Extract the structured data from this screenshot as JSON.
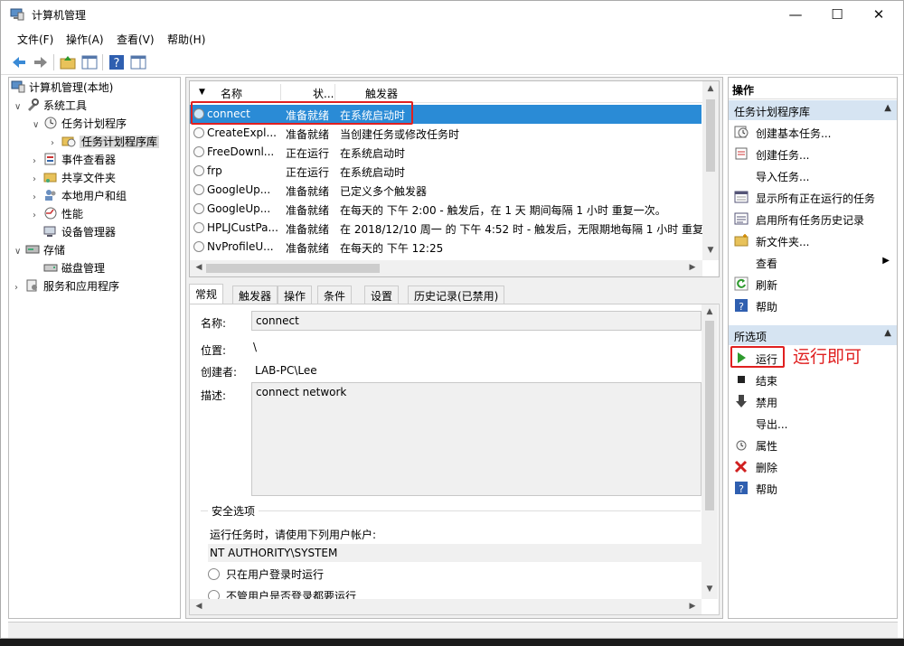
{
  "window": {
    "title": "计算机管理"
  },
  "menu": [
    "文件(F)",
    "操作(A)",
    "查看(V)",
    "帮助(H)"
  ],
  "tree": {
    "items": [
      {
        "label": "计算机管理(本地)",
        "level": 0,
        "expanded": true,
        "icon": "computer-mgmt-icon"
      },
      {
        "label": "系统工具",
        "level": 1,
        "expanded": true,
        "icon": "tools-icon"
      },
      {
        "label": "任务计划程序",
        "level": 2,
        "expanded": true,
        "icon": "clock-icon"
      },
      {
        "label": "任务计划程序库",
        "level": 3,
        "expanded": false,
        "icon": "folder-clock-icon",
        "selected": true
      },
      {
        "label": "事件查看器",
        "level": 2,
        "expanded": false,
        "icon": "event-viewer-icon"
      },
      {
        "label": "共享文件夹",
        "level": 2,
        "expanded": false,
        "icon": "shared-folder-icon"
      },
      {
        "label": "本地用户和组",
        "level": 2,
        "expanded": false,
        "icon": "users-icon"
      },
      {
        "label": "性能",
        "level": 2,
        "expanded": false,
        "icon": "performance-icon"
      },
      {
        "label": "设备管理器",
        "level": 2,
        "expanded": null,
        "icon": "device-manager-icon"
      },
      {
        "label": "存储",
        "level": 1,
        "expanded": true,
        "icon": "storage-icon"
      },
      {
        "label": "磁盘管理",
        "level": 2,
        "expanded": null,
        "icon": "disk-icon"
      },
      {
        "label": "服务和应用程序",
        "level": 1,
        "expanded": false,
        "icon": "services-icon"
      }
    ]
  },
  "task_list": {
    "columns": [
      "名称",
      "状...",
      "触发器"
    ],
    "rows": [
      {
        "name": "connect",
        "status": "准备就绪",
        "trigger": "在系统启动时",
        "selected": true
      },
      {
        "name": "CreateExpl...",
        "status": "准备就绪",
        "trigger": "当创建任务或修改任务时"
      },
      {
        "name": "FreeDownl...",
        "status": "正在运行",
        "trigger": "在系统启动时"
      },
      {
        "name": "frp",
        "status": "正在运行",
        "trigger": "在系统启动时"
      },
      {
        "name": "GoogleUp...",
        "status": "准备就绪",
        "trigger": "已定义多个触发器"
      },
      {
        "name": "GoogleUp...",
        "status": "准备就绪",
        "trigger": "在每天的 下午 2:00 - 触发后，在 1 天 期间每隔 1 小时 重复一次。"
      },
      {
        "name": "HPLJCustPa...",
        "status": "准备就绪",
        "trigger": "在 2018/12/10 周一 的 下午 4:52 时 - 触发后，无限期地每隔 1 小时 重复一"
      },
      {
        "name": "NvProfileU...",
        "status": "准备就绪",
        "trigger": "在每天的 下午 12:25"
      }
    ]
  },
  "tabs": [
    "常规",
    "触发器",
    "操作",
    "条件",
    "设置",
    "历史记录(已禁用)"
  ],
  "details": {
    "name_label": "名称:",
    "name_value": "connect",
    "location_label": "位置:",
    "location_value": "\\",
    "author_label": "创建者:",
    "author_value": "LAB-PC\\Lee",
    "description_label": "描述:",
    "description_value": "connect network",
    "security_title": "安全选项",
    "run_as_label": "运行任务时，请使用下列用户帐户:",
    "run_as_value": "NT AUTHORITY\\SYSTEM",
    "option1": "只在用户登录时运行",
    "option2": "不管用户是否登录都要运行"
  },
  "actions": {
    "header": "操作",
    "section1": {
      "title": "任务计划程序库",
      "items": [
        {
          "label": "创建基本任务...",
          "icon": "create-basic-task-icon"
        },
        {
          "label": "创建任务...",
          "icon": "create-task-icon"
        },
        {
          "label": "导入任务...",
          "icon": ""
        },
        {
          "label": "显示所有正在运行的任务",
          "icon": "running-tasks-icon"
        },
        {
          "label": "启用所有任务历史记录",
          "icon": "history-icon"
        },
        {
          "label": "新文件夹...",
          "icon": "new-folder-icon"
        },
        {
          "label": "查看",
          "icon": "",
          "submenu": true
        },
        {
          "label": "刷新",
          "icon": "refresh-icon"
        },
        {
          "label": "帮助",
          "icon": "help-icon"
        }
      ]
    },
    "section2": {
      "title": "所选项",
      "items": [
        {
          "label": "运行",
          "icon": "run-icon"
        },
        {
          "label": "结束",
          "icon": "end-icon"
        },
        {
          "label": "禁用",
          "icon": "disable-icon"
        },
        {
          "label": "导出...",
          "icon": ""
        },
        {
          "label": "属性",
          "icon": "properties-icon"
        },
        {
          "label": "删除",
          "icon": "delete-icon"
        },
        {
          "label": "帮助",
          "icon": "help-icon"
        }
      ]
    }
  },
  "annotation": "运行即可",
  "colors": {
    "selection": "#2a8bd6",
    "annotation": "#e02020",
    "section_header": "#d6e4f2"
  }
}
